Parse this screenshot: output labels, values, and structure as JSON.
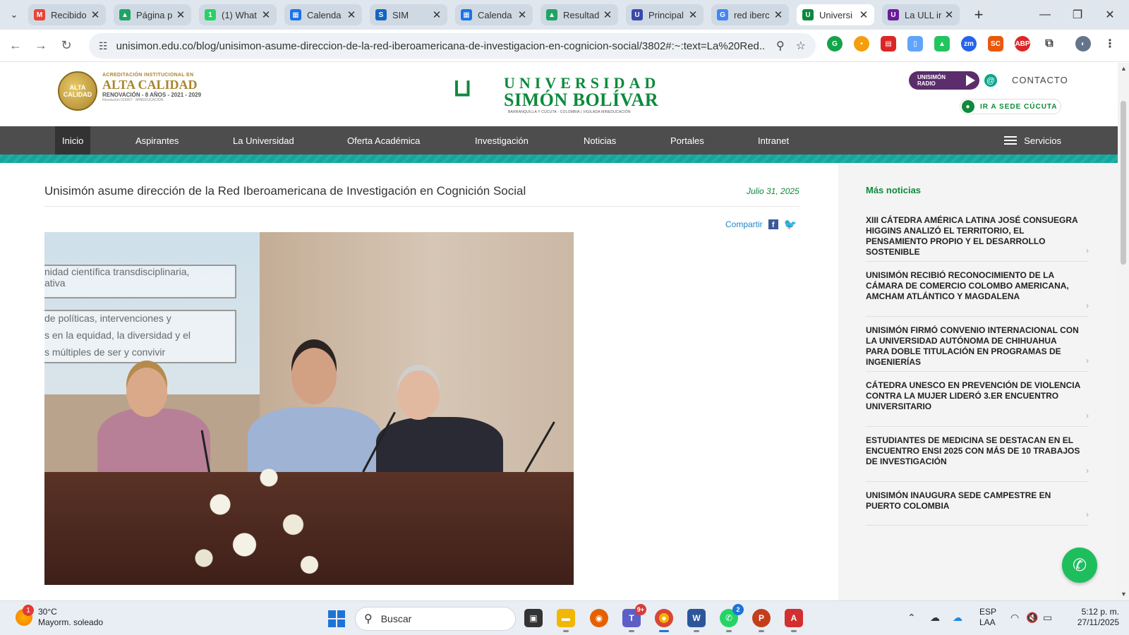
{
  "browser": {
    "tabs": [
      {
        "title": "Recibido",
        "fav": "M",
        "color": "#ea4335"
      },
      {
        "title": "Página p",
        "fav": "▲",
        "color": "#1fa463"
      },
      {
        "title": "(1) What",
        "fav": "1",
        "color": "#25d366"
      },
      {
        "title": "Calenda",
        "fav": "▦",
        "color": "#1a73e8"
      },
      {
        "title": "SIM",
        "fav": "S",
        "color": "#1565c0"
      },
      {
        "title": "Calenda",
        "fav": "▦",
        "color": "#1a73e8"
      },
      {
        "title": "Resultad",
        "fav": "▲",
        "color": "#1fa463"
      },
      {
        "title": "Principal",
        "fav": "U",
        "color": "#3949ab"
      },
      {
        "title": "red iberc",
        "fav": "G",
        "color": "#4285f4"
      },
      {
        "title": "Universi",
        "fav": "U",
        "color": "#0d8a3c"
      },
      {
        "title": "La ULL ir",
        "fav": "U",
        "color": "#6a1b9a"
      }
    ],
    "url": "unisimon.edu.co/blog/unisimon-asume-direccion-de-la-red-iberoamericana-de-investigacion-en-cognicion-social/3802#:~:text=La%20Red..."
  },
  "header": {
    "accreditation": {
      "line1": "ACREDITACIÓN INSTITUCIONAL EN",
      "line2": "ALTA CALIDAD",
      "line3": "RENOVACIÓN - 8 AÑOS - 2021 - 2029",
      "line4": "Resolución 015667 - MINEDUCACIÓN",
      "seal": "ALTA CALIDAD"
    },
    "logo": {
      "line1": "UNIVERSIDAD",
      "line2": "SIMÓN BOLÍVAR",
      "sub": "BARRANQUILLA Y CÚCUTA - COLOMBIA  |  VIGILADA MINEDUCACIÓN"
    },
    "radio_label": "UNISIMÓN RADIO",
    "contact_label": "CONTACTO",
    "sede_label": "IR A SEDE CÚCUTA"
  },
  "nav": {
    "items": [
      "Inicio",
      "Aspirantes",
      "La Universidad",
      "Oferta Académica",
      "Investigación",
      "Noticias",
      "Portales",
      "Intranet"
    ],
    "servicios": "Servicios"
  },
  "article": {
    "title": "Unisimón asume dirección de la Red Iberoamericana de Investigación en Cognición Social",
    "date": "Julio 31, 2025",
    "share_label": "Compartir",
    "slide_lines": [
      "nidad científica transdisciplinaria,",
      "ativa",
      "de políticas, intervenciones y",
      "s en la equidad, la diversidad y el",
      "s múltiples de ser y convivir"
    ]
  },
  "sidebar": {
    "heading": "Más noticias",
    "news": [
      "XIII CÁTEDRA AMÉRICA LATINA JOSÉ CONSUEGRA HIGGINS ANALIZÓ EL TERRITORIO, EL PENSAMIENTO PROPIO Y EL DESARROLLO SOSTENIBLE",
      "UNISIMÓN RECIBIÓ RECONOCIMIENTO DE LA CÁMARA DE COMERCIO COLOMBO AMERICANA, AMCHAM ATLÁNTICO Y MAGDALENA",
      "UNISIMÓN FIRMÓ CONVENIO INTERNACIONAL CON LA UNIVERSIDAD AUTÓNOMA DE CHIHUAHUA PARA DOBLE TITULACIÓN EN PROGRAMAS DE INGENIERÍAS",
      "CÁTEDRA UNESCO EN PREVENCIÓN DE VIOLENCIA CONTRA LA MUJER LIDERÓ 3.ER ENCUENTRO UNIVERSITARIO",
      "ESTUDIANTES DE MEDICINA SE DESTACAN EN EL ENCUENTRO ENSI 2025 CON MÁS DE 10 TRABAJOS DE INVESTIGACIÓN",
      "UNISIMÓN INAUGURA SEDE CAMPESTRE EN PUERTO COLOMBIA"
    ]
  },
  "taskbar": {
    "weather_temp": "30°C",
    "weather_desc": "Mayorm. soleado",
    "weather_badge": "1",
    "search_label": "Buscar",
    "teams_badge": "9+",
    "whatsapp_badge": "2",
    "lang1": "ESP",
    "lang2": "LAA",
    "time": "5:12 p. m.",
    "date": "27/11/2025"
  }
}
